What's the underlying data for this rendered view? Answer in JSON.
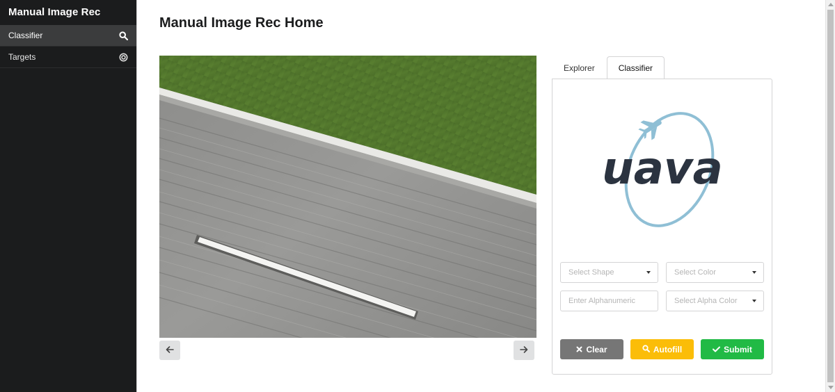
{
  "sidebar": {
    "title": "Manual Image Rec",
    "items": [
      {
        "label": "Classifier",
        "icon": "search-icon",
        "active": true
      },
      {
        "label": "Targets",
        "icon": "target-icon",
        "active": false
      }
    ]
  },
  "main": {
    "title": "Manual Image Rec Home",
    "image": {
      "description_icon": "aerial-runway-image",
      "prev_icon": "arrow-left-icon",
      "next_icon": "arrow-right-icon"
    },
    "tabs": [
      {
        "label": "Explorer",
        "active": false
      },
      {
        "label": "Classifier",
        "active": true
      }
    ],
    "logo": {
      "text": "uava",
      "text_color": "#2b3340",
      "ring_color": "#8fbfd5"
    },
    "form": {
      "shape": {
        "placeholder": "Select Shape"
      },
      "color": {
        "placeholder": "Select Color"
      },
      "alphanumeric": {
        "placeholder": "Enter Alphanumeric"
      },
      "alpha_color": {
        "placeholder": "Select Alpha Color"
      }
    },
    "buttons": {
      "clear": {
        "label": "Clear",
        "color": "#767676"
      },
      "autofill": {
        "label": "Autofill",
        "color": "#fbbd08"
      },
      "submit": {
        "label": "Submit",
        "color": "#21ba45"
      }
    }
  }
}
